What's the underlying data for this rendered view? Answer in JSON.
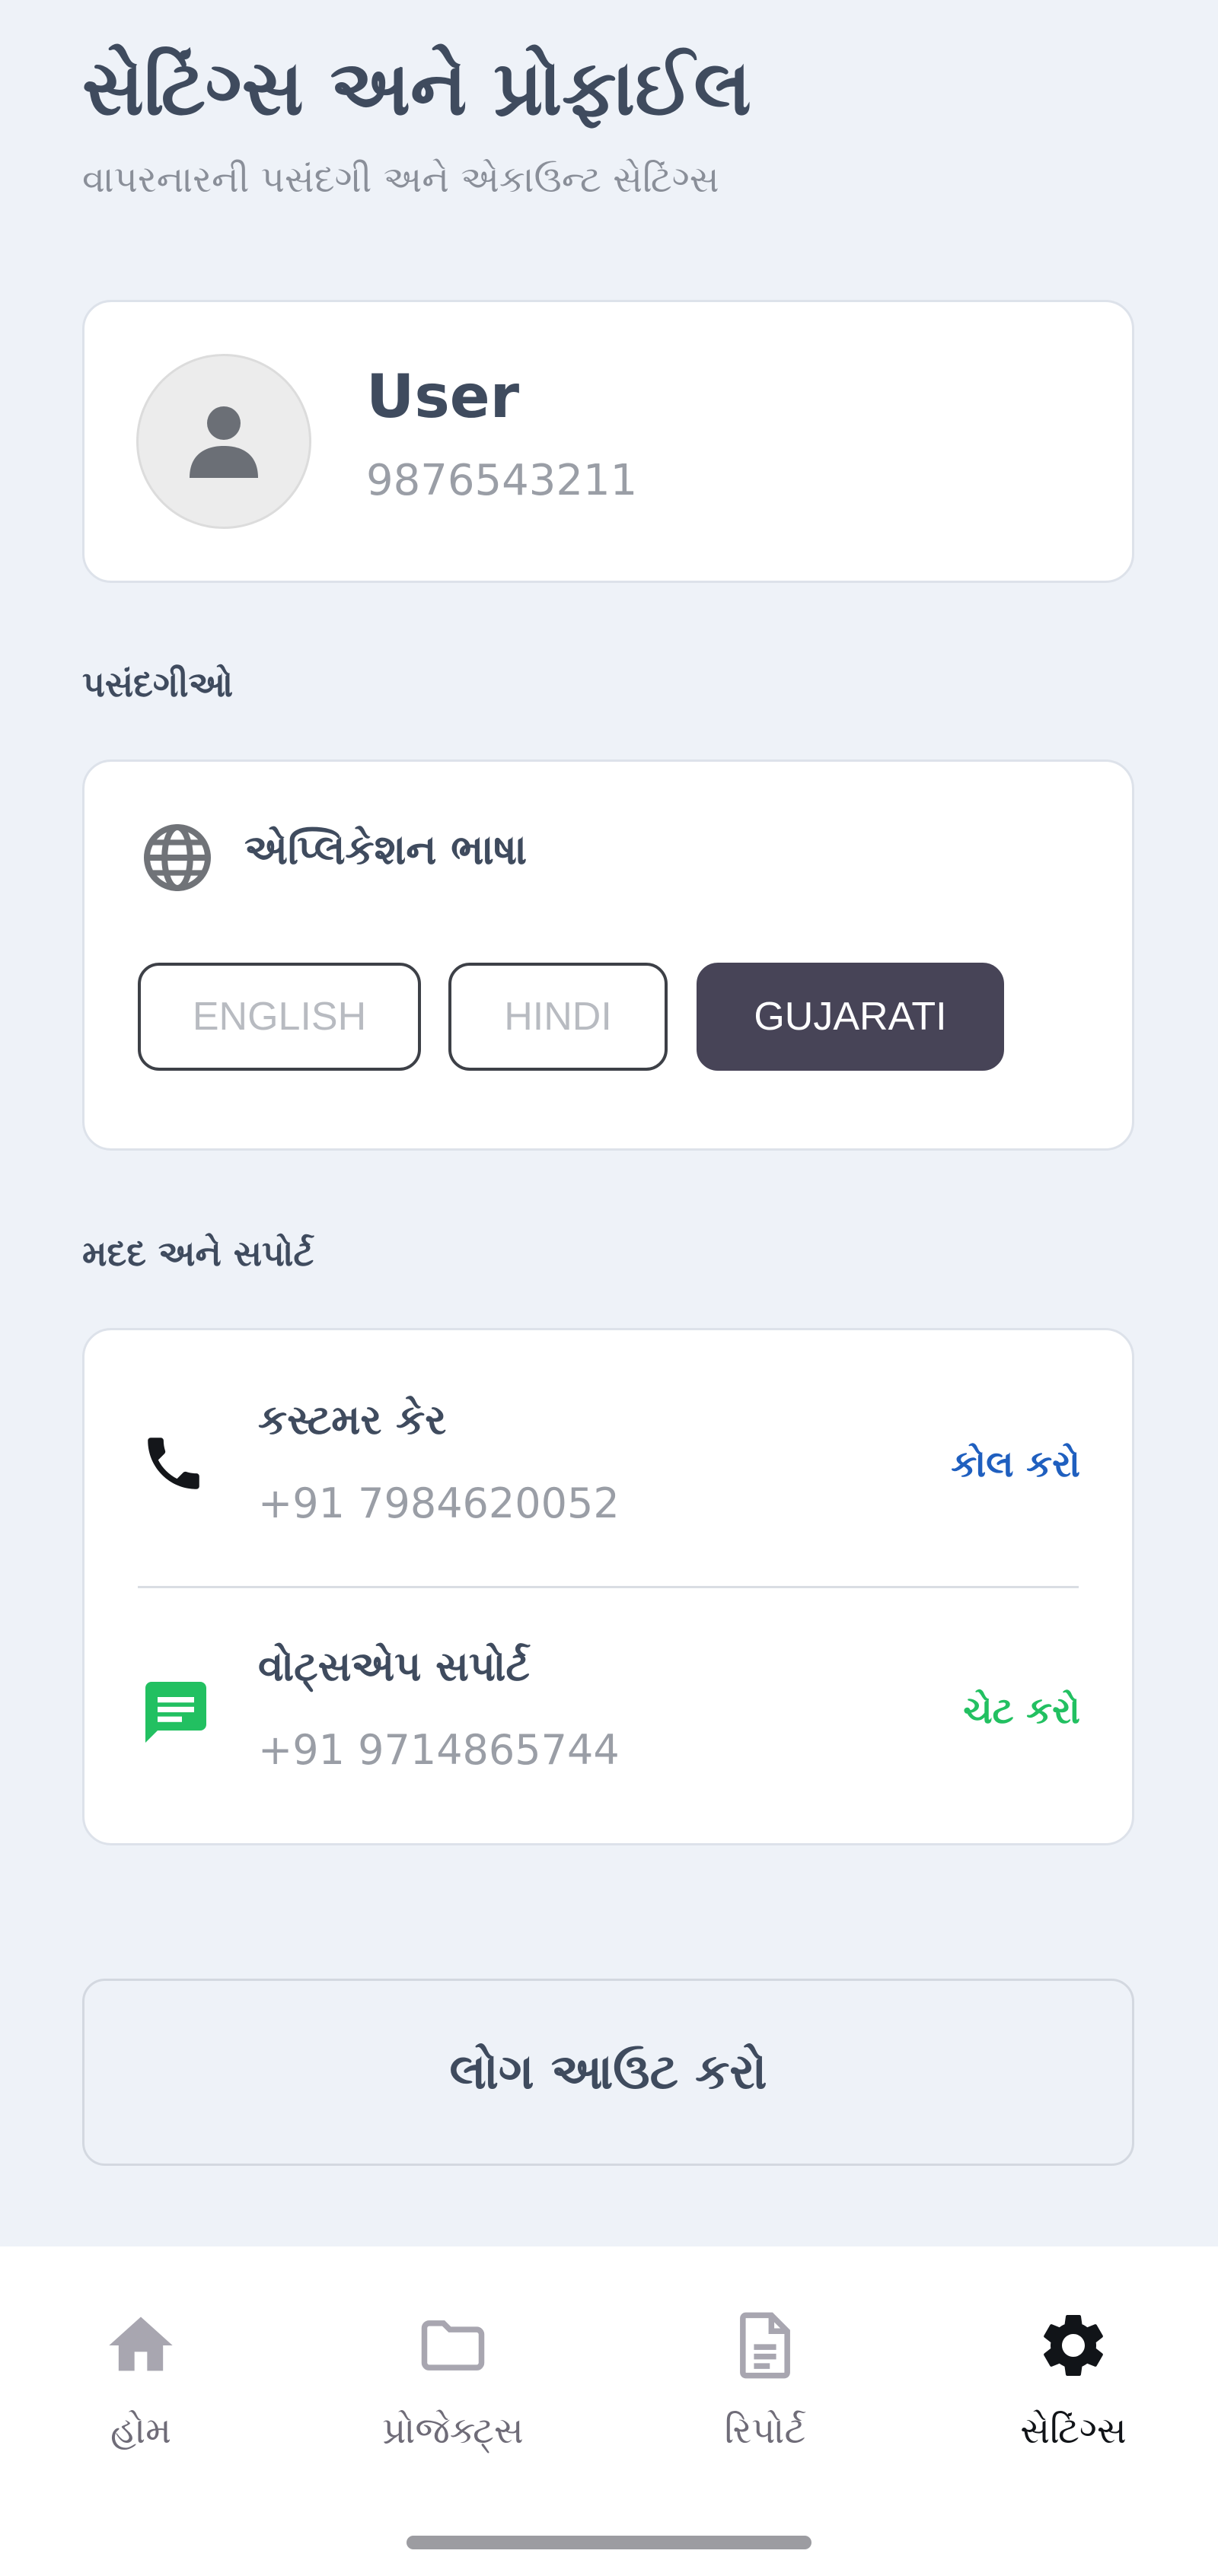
{
  "header": {
    "title": "સેટિંગ્સ અને પ્રોફાઈલ",
    "subtitle": "વાપરનારની પસંદગી અને એકાઉન્ટ સેટિંગ્સ"
  },
  "profile": {
    "name": "User",
    "phone": "9876543211",
    "avatar_icon": "person-icon"
  },
  "preferences": {
    "section_label": "પસંદગીઓ",
    "language_title": "એપ્લિકેશન ભાષા",
    "language_icon": "globe-icon",
    "options": [
      {
        "label": "ENGLISH",
        "selected": false
      },
      {
        "label": "HINDI",
        "selected": false
      },
      {
        "label": "GUJARATI",
        "selected": true
      }
    ]
  },
  "support": {
    "section_label": "મદદ અને સપોર્ટ",
    "customer_care": {
      "title": "કસ્ટમર કેર",
      "phone": "+91 7984620052",
      "action": "કોલ કરો",
      "action_color": "#1f5fbf",
      "icon": "phone-icon"
    },
    "whatsapp": {
      "title": "વોટ્સએપ સપોર્ટ",
      "phone": "+91 9714865744",
      "action": "ચેટ કરો",
      "action_color": "#22c061",
      "icon": "chat-icon"
    }
  },
  "logout": {
    "label": "લોગ આઉટ કરો"
  },
  "nav": {
    "items": [
      {
        "label": "હોમ",
        "icon": "home-icon",
        "active": false
      },
      {
        "label": "પ્રોજેક્ટ્સ",
        "icon": "folder-icon",
        "active": false
      },
      {
        "label": "રિપોર્ટ",
        "icon": "document-icon",
        "active": false
      },
      {
        "label": "સેટિંગ્સ",
        "icon": "gear-icon",
        "active": true
      }
    ],
    "active_color": "#111418",
    "inactive_color": "#a8a6b0"
  }
}
